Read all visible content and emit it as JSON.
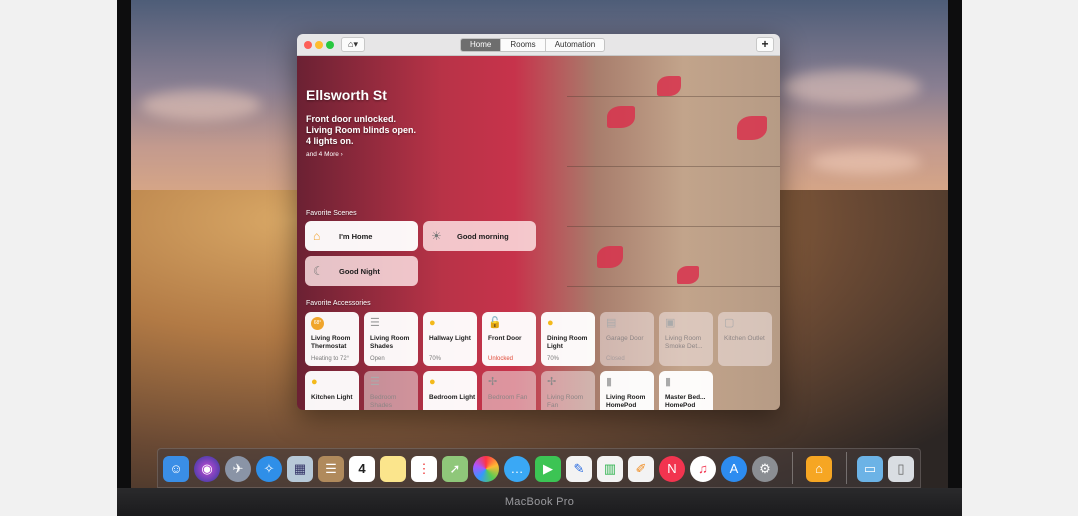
{
  "window": {
    "tabs": [
      {
        "label": "Home",
        "selected": true
      },
      {
        "label": "Rooms",
        "selected": false
      },
      {
        "label": "Automation",
        "selected": false
      }
    ],
    "home_menu_icon": "house-icon",
    "add_icon": "plus-icon"
  },
  "home": {
    "title": "Ellsworth St",
    "status_lines": [
      "Front door unlocked.",
      "Living Room blinds open.",
      "4 lights on."
    ],
    "more": "and 4 More ›"
  },
  "scenes_label": "Favorite Scenes",
  "scenes": [
    {
      "label": "I'm Home",
      "icon": "person-arriving-icon",
      "active": true
    },
    {
      "label": "Good morning",
      "icon": "sunrise-icon",
      "active": false
    },
    {
      "label": "Good Night",
      "icon": "moon-house-icon",
      "active": false
    }
  ],
  "accessories_label": "Favorite Accessories",
  "accessories": [
    {
      "name": "Living Room Thermostat",
      "status": "Heating to 72°",
      "icon": "thermostat-icon",
      "active": true
    },
    {
      "name": "Living Room Shades",
      "status": "Open",
      "icon": "shades-icon",
      "active": true
    },
    {
      "name": "Hallway Light",
      "status": "70%",
      "icon": "lightbulb-icon",
      "active": true
    },
    {
      "name": "Front Door",
      "status": "Unlocked",
      "icon": "unlocked-icon",
      "active": true,
      "warn": true
    },
    {
      "name": "Dining Room Light",
      "status": "70%",
      "icon": "lightbulb-icon",
      "active": true
    },
    {
      "name": "Garage Door",
      "status": "Closed",
      "icon": "garage-icon",
      "active": false
    },
    {
      "name": "Living Room Smoke Det...",
      "status": "",
      "icon": "smoke-detector-icon",
      "active": false
    },
    {
      "name": "Kitchen Outlet",
      "status": "",
      "icon": "outlet-icon",
      "active": false
    },
    {
      "name": "Kitchen Light",
      "status": "",
      "icon": "lightbulb-icon",
      "active": true
    },
    {
      "name": "Bedroom Shades",
      "status": "",
      "icon": "shades-icon",
      "active": false
    },
    {
      "name": "Bedroom Light",
      "status": "",
      "icon": "lightbulb-icon",
      "active": true
    },
    {
      "name": "Bedroom Fan",
      "status": "",
      "icon": "fan-icon",
      "active": false
    },
    {
      "name": "Living Room Fan",
      "status": "",
      "icon": "fan-icon",
      "active": false
    },
    {
      "name": "Living Room HomePod",
      "status": "",
      "icon": "homepod-icon",
      "active": true
    },
    {
      "name": "Master Bed... HomePod",
      "status": "",
      "icon": "homepod-icon",
      "active": true
    }
  ],
  "dock_apps": [
    "finder-icon",
    "siri-icon",
    "launchpad-icon",
    "safari-icon",
    "photo-browser-icon",
    "contacts-icon",
    "calendar-icon",
    "notes-icon",
    "reminders-icon",
    "maps-icon",
    "photos-icon",
    "messages-icon",
    "facetime-icon",
    "keynote-icon",
    "numbers-icon",
    "pages-icon",
    "news-icon",
    "music-icon",
    "app-store-icon",
    "system-preferences-icon",
    "home-icon",
    "downloads-folder-icon",
    "trash-icon"
  ],
  "dock_calendar_day": "4",
  "laptop_label": "MacBook Pro"
}
